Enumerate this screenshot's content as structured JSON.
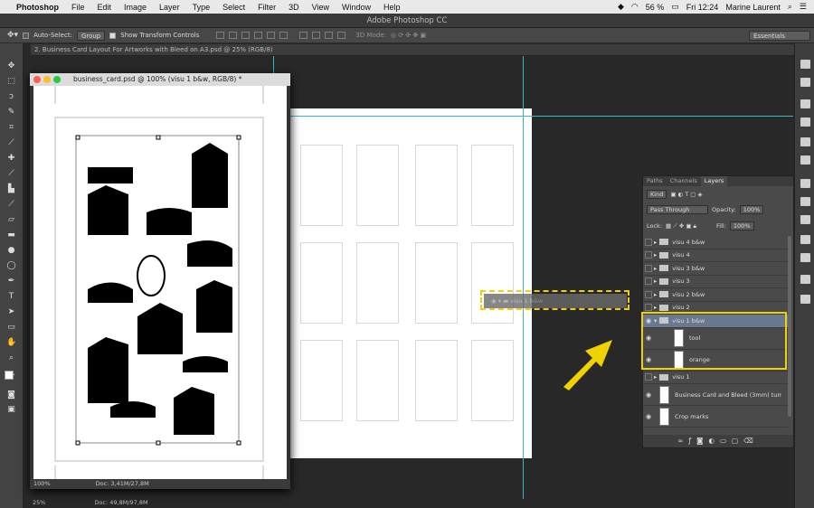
{
  "menubar": {
    "app": "Photoshop",
    "items": [
      "File",
      "Edit",
      "Image",
      "Layer",
      "Type",
      "Select",
      "Filter",
      "3D",
      "View",
      "Window",
      "Help"
    ],
    "battery": "56 %",
    "clock": "Fri 12:24",
    "user": "Marine Laurent"
  },
  "window_title": "Adobe Photoshop CC",
  "options": {
    "auto_select": "Auto-Select:",
    "group": "Group",
    "transform": "Show Transform Controls",
    "mode3d": "3D Mode:",
    "workspace": "Essentials"
  },
  "doc_tab": "2. Business Card Layout For Artworks with Bleed on A3.psd @ 25% (RGB/8)",
  "floating": {
    "title": "business_card.psd @ 100% (visu 1 b&w, RGB/8) *",
    "zoom": "100%",
    "doc": "Doc: 3,41M/27,8M"
  },
  "main_status": {
    "zoom": "25%",
    "doc": "Doc: 49,8M/97,8M"
  },
  "drag_ghost": "visu 1 b&w",
  "layers_panel": {
    "tabs": [
      "Paths",
      "Channels",
      "Layers"
    ],
    "kind": "Kind",
    "blend": "Pass Through",
    "opacity_label": "Opacity:",
    "opacity": "100%",
    "lock_label": "Lock:",
    "fill_label": "Fill:",
    "fill": "100%",
    "layers": [
      {
        "name": "visu 4 b&w",
        "type": "group",
        "visible": false
      },
      {
        "name": "visu 4",
        "type": "group",
        "visible": false
      },
      {
        "name": "visu 3 b&w",
        "type": "group",
        "visible": false
      },
      {
        "name": "visu 3",
        "type": "group",
        "visible": false
      },
      {
        "name": "visu 2 b&w",
        "type": "group",
        "visible": false
      },
      {
        "name": "visu 2",
        "type": "group",
        "visible": false
      },
      {
        "name": "visu 1 b&w",
        "type": "group",
        "visible": true,
        "selected": true
      },
      {
        "name": "tool",
        "type": "layer",
        "visible": true
      },
      {
        "name": "orange",
        "type": "layer",
        "visible": true
      },
      {
        "name": "visu 1",
        "type": "group",
        "visible": false
      },
      {
        "name": "Business Card and Bleed (3mm) turn of...",
        "type": "layer",
        "visible": true
      },
      {
        "name": "Crop marks",
        "type": "layer",
        "visible": true
      }
    ]
  },
  "colors": {
    "highlight": "#f0d200",
    "guide": "#39b6c7",
    "selected_row": "#6a7990"
  }
}
